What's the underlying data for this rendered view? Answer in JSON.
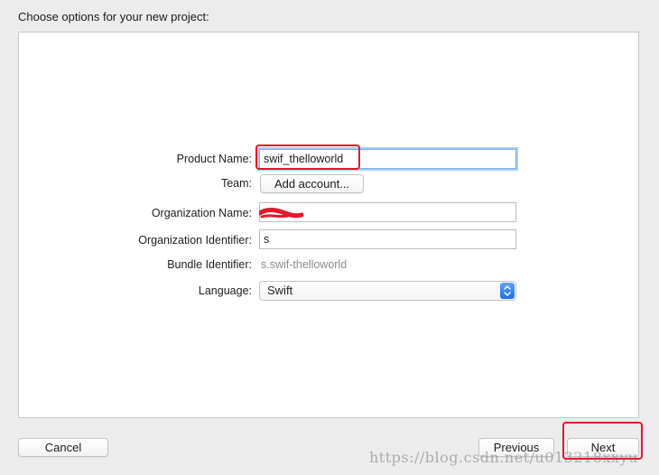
{
  "header": {
    "title": "Choose options for your new project:"
  },
  "form": {
    "product_name_label": "Product Name:",
    "product_name_value": "swif_thelloworld",
    "team_label": "Team:",
    "add_account_button": "Add account...",
    "organization_name_label": "Organization Name:",
    "organization_identifier_label": "Organization Identifier:",
    "organization_identifier_value": "s",
    "bundle_identifier_label": "Bundle Identifier:",
    "bundle_identifier_value": "s.swif-thelloworld",
    "language_label": "Language:",
    "language_selected": "Swift"
  },
  "footer": {
    "cancel_label": "Cancel",
    "previous_label": "Previous",
    "next_label": "Next"
  },
  "watermark": {
    "text": "https://blog.csdn.net/u013218xxyu"
  },
  "colors": {
    "background": "#ececec",
    "panel": "#ffffff",
    "focus_ring": "#a9cdf3",
    "select_accent": "#1f6fe5",
    "annotation_red": "#e0192c"
  },
  "icons": {
    "select_arrows": "chevron-up-down-icon"
  }
}
